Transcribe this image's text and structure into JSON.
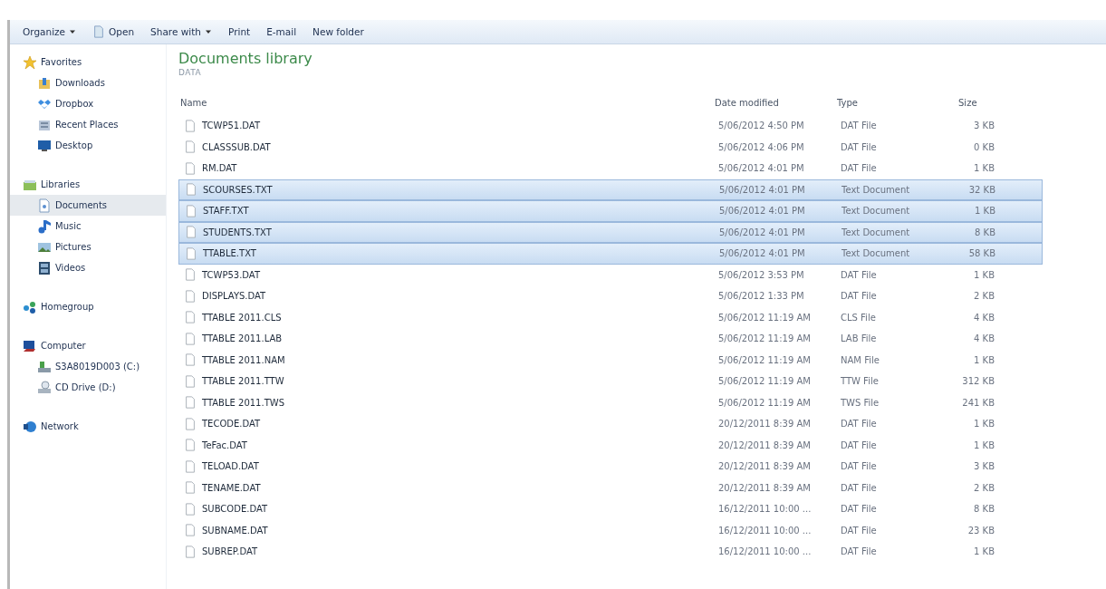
{
  "toolbar": [
    {
      "label": "Organize",
      "dropdown": true,
      "icon": false
    },
    {
      "label": "Open",
      "dropdown": false,
      "icon": true
    },
    {
      "label": "Share with",
      "dropdown": true,
      "icon": false
    },
    {
      "label": "Print",
      "dropdown": false,
      "icon": false
    },
    {
      "label": "E-mail",
      "dropdown": false,
      "icon": false
    },
    {
      "label": "New folder",
      "dropdown": false,
      "icon": false
    }
  ],
  "sidebar": {
    "groups": [
      {
        "label": "Favorites",
        "kind": "star",
        "selected": false,
        "children": [
          {
            "label": "Downloads",
            "kind": "download",
            "selected": false
          },
          {
            "label": "Dropbox",
            "kind": "dropbox",
            "selected": false
          },
          {
            "label": "Recent Places",
            "kind": "recent",
            "selected": false
          },
          {
            "label": "Desktop",
            "kind": "desktop",
            "selected": false
          }
        ]
      },
      {
        "label": "Libraries",
        "kind": "library",
        "selected": false,
        "children": [
          {
            "label": "Documents",
            "kind": "document",
            "selected": true
          },
          {
            "label": "Music",
            "kind": "music",
            "selected": false
          },
          {
            "label": "Pictures",
            "kind": "picture",
            "selected": false
          },
          {
            "label": "Videos",
            "kind": "video",
            "selected": false
          }
        ]
      },
      {
        "label": "Homegroup",
        "kind": "homegroup",
        "selected": false
      },
      {
        "label": "Computer",
        "kind": "computer",
        "selected": false,
        "children": [
          {
            "label": "S3A8019D003 (C:)",
            "kind": "drive",
            "selected": false
          },
          {
            "label": "CD Drive (D:)",
            "kind": "cd",
            "selected": false
          }
        ]
      },
      {
        "label": "Network",
        "kind": "network",
        "selected": false
      }
    ]
  },
  "library": {
    "title": "Documents library",
    "subtitle": "DATA"
  },
  "table": {
    "columns": [
      "Name",
      "Date modified",
      "Type",
      "Size"
    ],
    "rows": [
      {
        "name": "TCWP51.DAT",
        "date": "5/06/2012 4:50 PM",
        "type": "DAT File",
        "size": "3 KB",
        "selected": false
      },
      {
        "name": "CLASSSUB.DAT",
        "date": "5/06/2012 4:06 PM",
        "type": "DAT File",
        "size": "0 KB",
        "selected": false
      },
      {
        "name": "RM.DAT",
        "date": "5/06/2012 4:01 PM",
        "type": "DAT File",
        "size": "1 KB",
        "selected": false
      },
      {
        "name": "SCOURSES.TXT",
        "date": "5/06/2012 4:01 PM",
        "type": "Text Document",
        "size": "32 KB",
        "selected": true
      },
      {
        "name": "STAFF.TXT",
        "date": "5/06/2012 4:01 PM",
        "type": "Text Document",
        "size": "1 KB",
        "selected": true
      },
      {
        "name": "STUDENTS.TXT",
        "date": "5/06/2012 4:01 PM",
        "type": "Text Document",
        "size": "8 KB",
        "selected": true
      },
      {
        "name": "TTABLE.TXT",
        "date": "5/06/2012 4:01 PM",
        "type": "Text Document",
        "size": "58 KB",
        "selected": true
      },
      {
        "name": "TCWP53.DAT",
        "date": "5/06/2012 3:53 PM",
        "type": "DAT File",
        "size": "1 KB",
        "selected": false
      },
      {
        "name": "DISPLAYS.DAT",
        "date": "5/06/2012 1:33 PM",
        "type": "DAT File",
        "size": "2 KB",
        "selected": false
      },
      {
        "name": "TTABLE 2011.CLS",
        "date": "5/06/2012 11:19 AM",
        "type": "CLS File",
        "size": "4 KB",
        "selected": false
      },
      {
        "name": "TTABLE 2011.LAB",
        "date": "5/06/2012 11:19 AM",
        "type": "LAB File",
        "size": "4 KB",
        "selected": false
      },
      {
        "name": "TTABLE 2011.NAM",
        "date": "5/06/2012 11:19 AM",
        "type": "NAM File",
        "size": "1 KB",
        "selected": false
      },
      {
        "name": "TTABLE 2011.TTW",
        "date": "5/06/2012 11:19 AM",
        "type": "TTW File",
        "size": "312 KB",
        "selected": false
      },
      {
        "name": "TTABLE 2011.TWS",
        "date": "5/06/2012 11:19 AM",
        "type": "TWS File",
        "size": "241 KB",
        "selected": false
      },
      {
        "name": "TECODE.DAT",
        "date": "20/12/2011 8:39 AM",
        "type": "DAT File",
        "size": "1 KB",
        "selected": false
      },
      {
        "name": "TeFac.DAT",
        "date": "20/12/2011 8:39 AM",
        "type": "DAT File",
        "size": "1 KB",
        "selected": false
      },
      {
        "name": "TELOAD.DAT",
        "date": "20/12/2011 8:39 AM",
        "type": "DAT File",
        "size": "3 KB",
        "selected": false
      },
      {
        "name": "TENAME.DAT",
        "date": "20/12/2011 8:39 AM",
        "type": "DAT File",
        "size": "2 KB",
        "selected": false
      },
      {
        "name": "SUBCODE.DAT",
        "date": "16/12/2011 10:00 ...",
        "type": "DAT File",
        "size": "8 KB",
        "selected": false
      },
      {
        "name": "SUBNAME.DAT",
        "date": "16/12/2011 10:00 ...",
        "type": "DAT File",
        "size": "23 KB",
        "selected": false
      },
      {
        "name": "SUBREP.DAT",
        "date": "16/12/2011 10:00 ...",
        "type": "DAT File",
        "size": "1 KB",
        "selected": false
      }
    ]
  }
}
